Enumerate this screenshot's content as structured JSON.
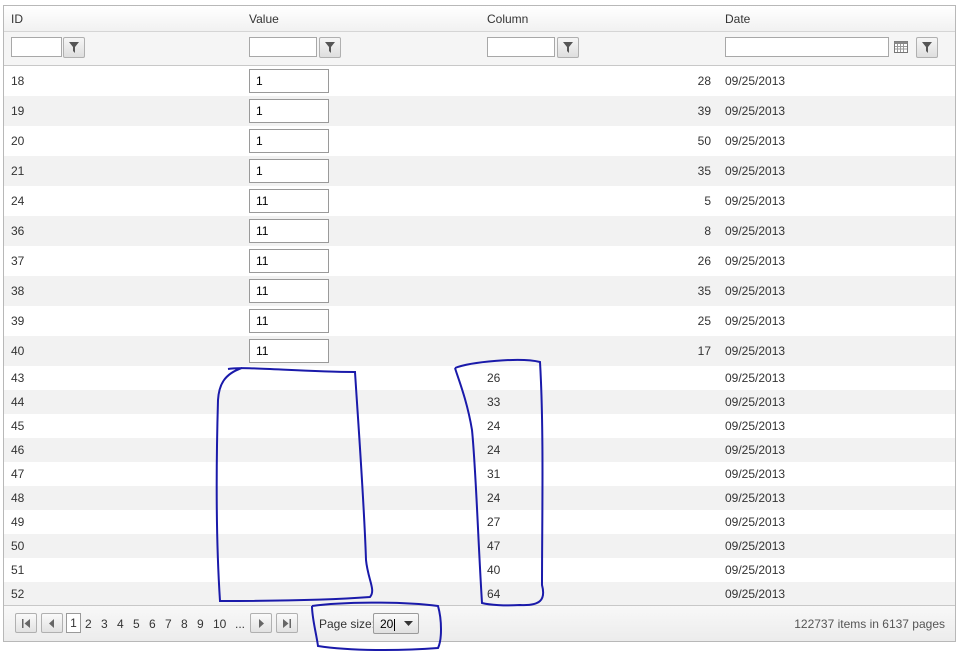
{
  "grid": {
    "columns": [
      {
        "key": "id",
        "title": "ID"
      },
      {
        "key": "value",
        "title": "Value"
      },
      {
        "key": "column",
        "title": "Column"
      },
      {
        "key": "date",
        "title": "Date"
      }
    ],
    "filters": {
      "id": "",
      "value": "",
      "column": "",
      "date": ""
    },
    "icons": {
      "filter": "filter-icon",
      "calendar": "calendar-icon"
    },
    "rows": [
      {
        "id": "18",
        "value": "1",
        "column": "28",
        "date": "09/25/2013",
        "editing": true
      },
      {
        "id": "19",
        "value": "1",
        "column": "39",
        "date": "09/25/2013",
        "editing": true
      },
      {
        "id": "20",
        "value": "1",
        "column": "50",
        "date": "09/25/2013",
        "editing": true
      },
      {
        "id": "21",
        "value": "1",
        "column": "35",
        "date": "09/25/2013",
        "editing": true
      },
      {
        "id": "24",
        "value": "11",
        "column": "5",
        "date": "09/25/2013",
        "editing": true
      },
      {
        "id": "36",
        "value": "11",
        "column": "8",
        "date": "09/25/2013",
        "editing": true
      },
      {
        "id": "37",
        "value": "11",
        "column": "26",
        "date": "09/25/2013",
        "editing": true
      },
      {
        "id": "38",
        "value": "11",
        "column": "35",
        "date": "09/25/2013",
        "editing": true
      },
      {
        "id": "39",
        "value": "11",
        "column": "25",
        "date": "09/25/2013",
        "editing": true
      },
      {
        "id": "40",
        "value": "11",
        "column": "17",
        "date": "09/25/2013",
        "editing": true
      },
      {
        "id": "43",
        "value": "",
        "column": "26",
        "date": "09/25/2013",
        "editing": false
      },
      {
        "id": "44",
        "value": "",
        "column": "33",
        "date": "09/25/2013",
        "editing": false
      },
      {
        "id": "45",
        "value": "",
        "column": "24",
        "date": "09/25/2013",
        "editing": false
      },
      {
        "id": "46",
        "value": "",
        "column": "24",
        "date": "09/25/2013",
        "editing": false
      },
      {
        "id": "47",
        "value": "",
        "column": "31",
        "date": "09/25/2013",
        "editing": false
      },
      {
        "id": "48",
        "value": "",
        "column": "24",
        "date": "09/25/2013",
        "editing": false
      },
      {
        "id": "49",
        "value": "",
        "column": "27",
        "date": "09/25/2013",
        "editing": false
      },
      {
        "id": "50",
        "value": "",
        "column": "47",
        "date": "09/25/2013",
        "editing": false
      },
      {
        "id": "51",
        "value": "",
        "column": "40",
        "date": "09/25/2013",
        "editing": false
      },
      {
        "id": "52",
        "value": "",
        "column": "64",
        "date": "09/25/2013",
        "editing": false
      }
    ]
  },
  "pager": {
    "current_page": "1",
    "pages": [
      "2",
      "3",
      "4",
      "5",
      "6",
      "7",
      "8",
      "9",
      "10"
    ],
    "more": "...",
    "page_size_label": "Page size:",
    "page_size": "20",
    "info": "122737 items in 6137 pages"
  },
  "annotation_color": "#1a1aaa"
}
